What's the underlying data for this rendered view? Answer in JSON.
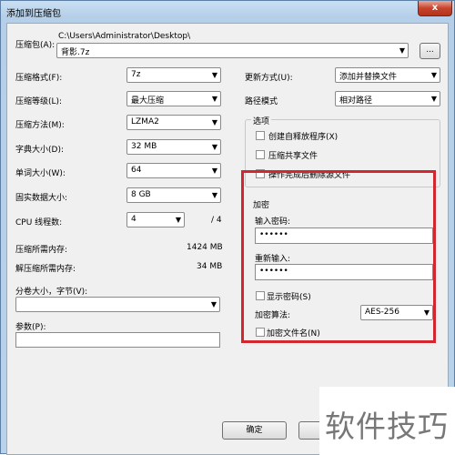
{
  "window": {
    "title": "添加到压缩包",
    "close_glyph": "x"
  },
  "archive": {
    "label": "压缩包(A):",
    "path_dir": "C:\\Users\\Administrator\\Desktop\\",
    "filename": "背影.7z",
    "browse_label": "..."
  },
  "left": {
    "format_label": "压缩格式(F):",
    "format_value": "7z",
    "level_label": "压缩等级(L):",
    "level_value": "最大压缩",
    "method_label": "压缩方法(M):",
    "method_value": "LZMA2",
    "dict_label": "字典大小(D):",
    "dict_value": "32 MB",
    "word_label": "单词大小(W):",
    "word_value": "64",
    "solid_label": "固实数据大小:",
    "solid_value": "8 GB",
    "threads_label": "CPU 线程数:",
    "threads_value": "4",
    "threads_max": "/ 4",
    "mem_comp_label": "压缩所需内存:",
    "mem_comp_value": "1424 MB",
    "mem_decomp_label": "解压缩所需内存:",
    "mem_decomp_value": "34 MB",
    "split_label": "分卷大小，字节(V):",
    "split_value": "",
    "params_label": "参数(P):",
    "params_value": ""
  },
  "right": {
    "update_label": "更新方式(U):",
    "update_value": "添加并替换文件",
    "path_label": "路径模式",
    "path_value": "相对路径",
    "options_title": "选项",
    "opt_sfx": "创建自释放程序(X)",
    "opt_shared": "压缩共享文件",
    "opt_delete": "操作完成后删除源文件"
  },
  "encryption": {
    "title": "加密",
    "password_label": "输入密码:",
    "password_value": "••••••",
    "reenter_label": "重新输入:",
    "reenter_value": "••••••",
    "show_password": "显示密码(S)",
    "method_label": "加密算法:",
    "method_value": "AES-256",
    "encrypt_names": "加密文件名(N)"
  },
  "buttons": {
    "ok": "确定"
  },
  "watermark": "软件技巧",
  "colors": {
    "highlight": "#d22630"
  }
}
